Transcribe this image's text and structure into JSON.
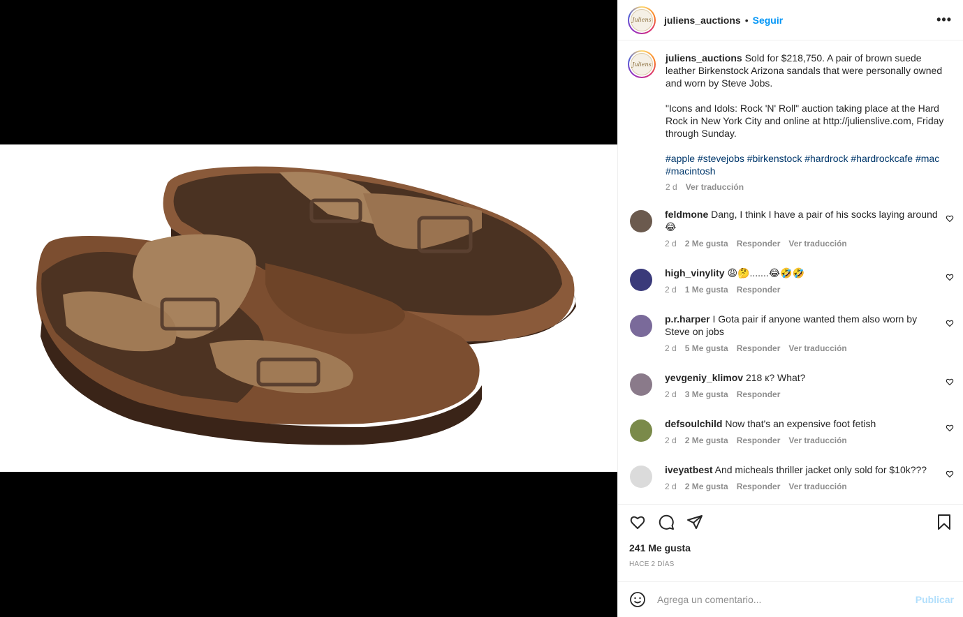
{
  "post": {
    "username": "juliens_auctions",
    "logo_text": "Juliens",
    "follow_label": "Seguir",
    "more_label": "•••"
  },
  "caption": {
    "username": "juliens_auctions",
    "text1": "Sold for $218,750. A pair of brown suede leather Birkenstock Arizona sandals that were personally owned and worn by Steve Jobs.",
    "text2": "\"Icons and Idols: Rock 'N' Roll\" auction taking place at the Hard Rock in New York City and online at http://julienslive.com, Friday through Sunday.",
    "hashtags": "#apple #stevejobs #birkenstock #hardrock #hardrockcafe #mac #macintosh",
    "time": "2 d",
    "translate": "Ver traducción"
  },
  "comments": [
    {
      "user": "feldmone",
      "text": "Dang, I think I have a pair of his socks laying around 😂",
      "time": "2 d",
      "likes": "2 Me gusta",
      "reply": "Responder",
      "translate": "Ver traducción",
      "avatar_color": "#6b5a4e"
    },
    {
      "user": "high_vinylity",
      "text": "😩🤔.......😂🤣🤣",
      "time": "2 d",
      "likes": "1 Me gusta",
      "reply": "Responder",
      "translate": "",
      "avatar_color": "#3a3a7a"
    },
    {
      "user": "p.r.harper",
      "text": "I Gota pair if anyone wanted them also worn by Steve on jobs",
      "time": "2 d",
      "likes": "5 Me gusta",
      "reply": "Responder",
      "translate": "Ver traducción",
      "avatar_color": "#7a6a9a"
    },
    {
      "user": "yevgeniy_klimov",
      "text": "218 к? What?",
      "time": "2 d",
      "likes": "3 Me gusta",
      "reply": "Responder",
      "translate": "",
      "avatar_color": "#8a7a8a"
    },
    {
      "user": "defsoulchild",
      "text": "Now that's an expensive foot fetish",
      "time": "2 d",
      "likes": "2 Me gusta",
      "reply": "Responder",
      "translate": "Ver traducción",
      "avatar_color": "#7a8a4a"
    },
    {
      "user": "iveyatbest",
      "text": "And micheals thriller jacket only sold for $10k???",
      "time": "2 d",
      "likes": "2 Me gusta",
      "reply": "Responder",
      "translate": "Ver traducción",
      "avatar_color": "#dbdbdb"
    }
  ],
  "footer": {
    "likes": "241 Me gusta",
    "posted": "HACE 2 DÍAS",
    "comment_placeholder": "Agrega un comentario...",
    "publish_label": "Publicar"
  },
  "colors": {
    "link_blue": "#0095f6",
    "hashtag_blue": "#00376b",
    "muted_gray": "#8e8e8e"
  }
}
